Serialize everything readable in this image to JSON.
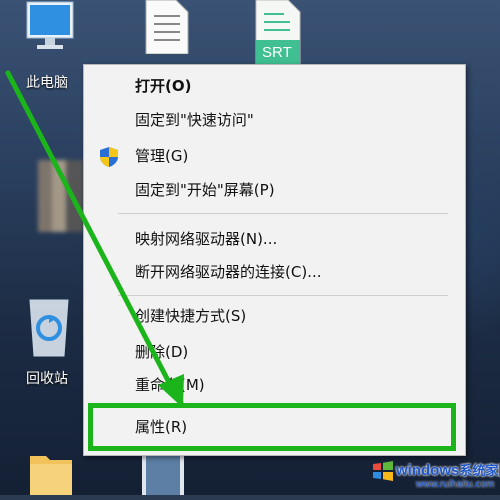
{
  "desktop": {
    "icons": {
      "this_pc": "此电脑",
      "recycle_bin": "回收站",
      "srt_file": "SRT"
    }
  },
  "context_menu": {
    "items": [
      {
        "label": "打开(O)",
        "bold": true
      },
      {
        "label": "固定到\"快速访问\""
      },
      {
        "label": "管理(G)",
        "icon": "uac-shield-icon"
      },
      {
        "label": "固定到\"开始\"屏幕(P)"
      },
      {
        "label": "映射网络驱动器(N)..."
      },
      {
        "label": "断开网络驱动器的连接(C)..."
      },
      {
        "label": "创建快捷方式(S)"
      },
      {
        "label": "删除(D)"
      },
      {
        "label": "重命名(M)"
      },
      {
        "label": "属性(R)"
      }
    ]
  },
  "annotation": {
    "highlight_color": "#1bb51b",
    "arrow_color": "#1bb51b"
  },
  "watermark": {
    "brand": "windows",
    "suffix": "系统家园",
    "url": "www.ruihaitu.com"
  }
}
